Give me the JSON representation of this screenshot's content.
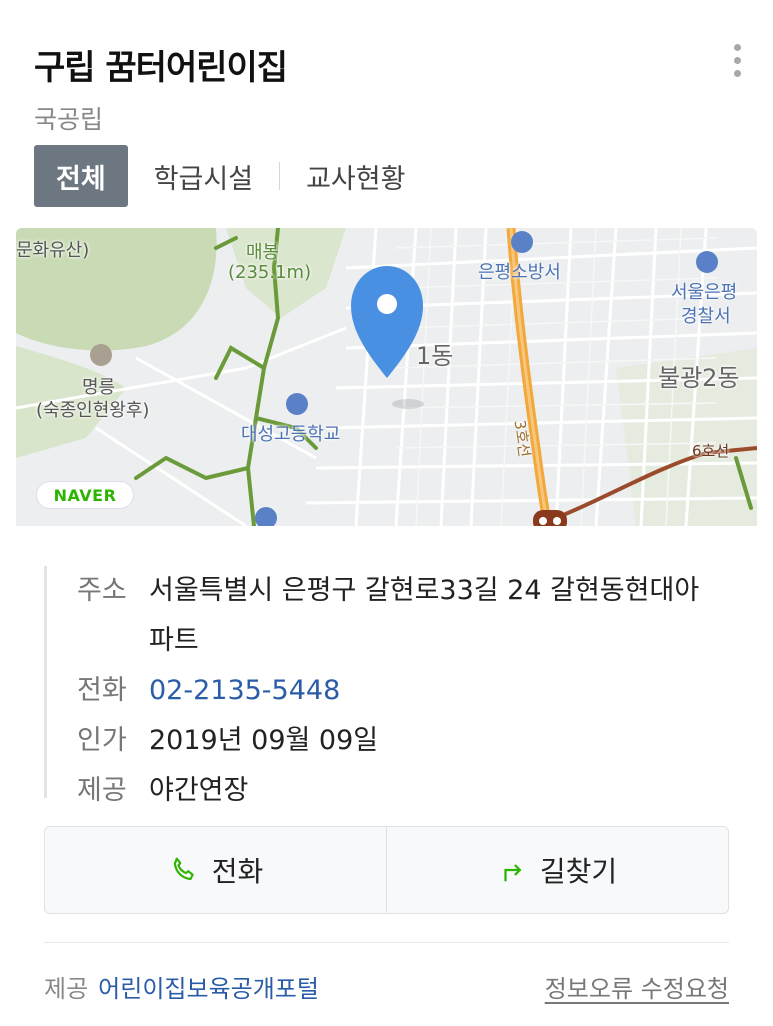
{
  "place": {
    "name": "구립 꿈터어린이집",
    "category": "국공립"
  },
  "tabs": [
    {
      "label": "전체",
      "active": true
    },
    {
      "label": "학급시설",
      "active": false
    },
    {
      "label": "교사현황",
      "active": false
    }
  ],
  "map": {
    "labels": {
      "heritage": "문화유산)",
      "mountain_name": "매봉",
      "mountain_height": "(235.1m)",
      "fire_station": "은평소방서",
      "police_line1": "서울은평",
      "police_line2": "경찰서",
      "dong1": "1동",
      "bulgwang": "불광2동",
      "tomb_line1": "명릉",
      "tomb_line2": "(숙종인현왕후)",
      "school": "대성고등학교",
      "line3": "3호선",
      "line6": "6호선"
    },
    "logo": "NAVER",
    "colors": {
      "park": "#c9dbb4",
      "road_main": "#f2a83a",
      "subway3": "#e9a24a",
      "subway6": "#9a4b2c",
      "trail": "#6b9a3a",
      "marker": "#4a90e2"
    }
  },
  "info": {
    "address_label": "주소",
    "address_value": "서울특별시 은평구 갈현로33길 24 갈현동현대아파트",
    "phone_label": "전화",
    "phone_value": "02-2135-5448",
    "license_label": "인가",
    "license_value": "2019년 09월 09일",
    "service_label": "제공",
    "service_value": "야간연장"
  },
  "actions": {
    "call_label": "전화",
    "call_icon": "phone-icon",
    "directions_label": "길찾기",
    "directions_icon": "turn-arrow-icon"
  },
  "footer": {
    "provider_label": "제공",
    "provider": "어린이집보육공개포털",
    "report": "정보오류 수정요청"
  }
}
